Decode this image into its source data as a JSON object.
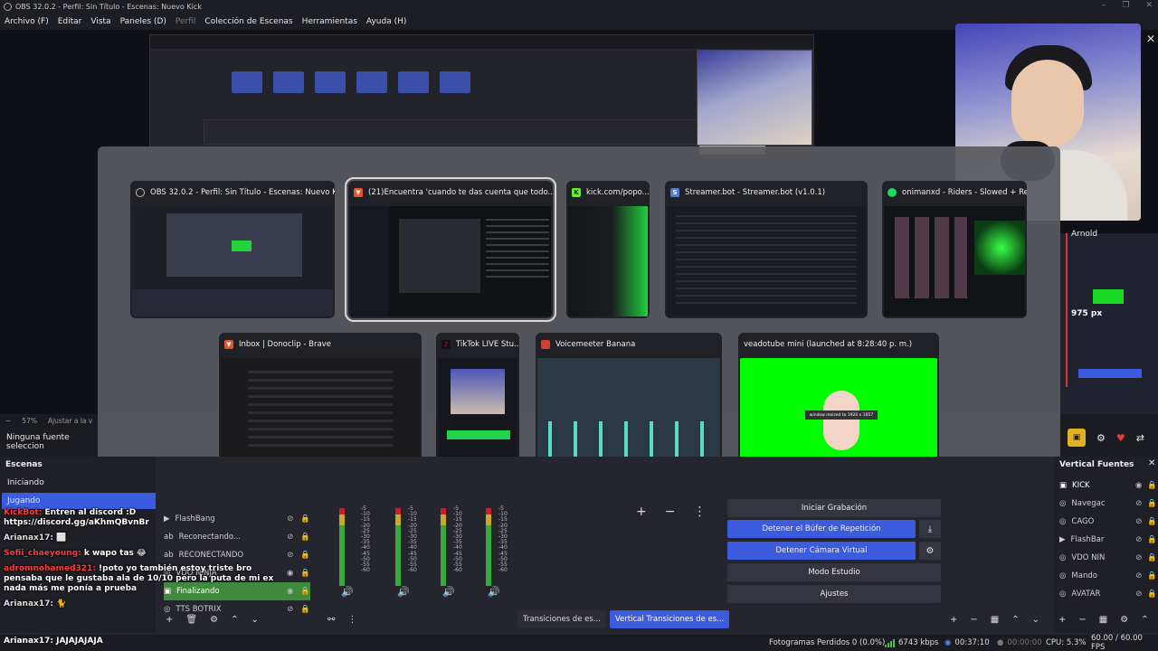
{
  "titlebar": {
    "title": "OBS 32.0.2 - Perfil: Sin Título - Escenas: Nuevo Kick"
  },
  "menu": [
    "Archivo (F)",
    "Editar",
    "Vista",
    "Paneles (D)",
    "Perfil",
    "Colección de Escenas",
    "Herramientas",
    "Ayuda (H)"
  ],
  "switcher": {
    "windows": [
      {
        "title": "OBS 32.0.2 - Perfil: Sin Título - Escenas: Nuevo Kick",
        "icon": "obs-icon",
        "color": "#b0b0b0"
      },
      {
        "title": "(21)Encuentra 'cuando te das cuenta que todo...",
        "icon": "brave-icon",
        "color": "#e5542d",
        "selected": true
      },
      {
        "title": "kick.com/popo...",
        "icon": "kick-icon",
        "color": "#53fc18"
      },
      {
        "title": "Streamer.bot - Streamer.bot (v1.0.1)",
        "icon": "streamerbot-icon",
        "color": "#4a7be0"
      },
      {
        "title": "onimanxd - Riders - Slowed + Rev...",
        "icon": "spotify-icon",
        "color": "#1ed760"
      },
      {
        "title": "Inbox | Donoclip - Brave",
        "icon": "brave-icon",
        "color": "#e5542d"
      },
      {
        "title": "TikTok LIVE Stu...",
        "icon": "tiktok-icon",
        "color": "#ee1d52"
      },
      {
        "title": "Voicemeeter Banana",
        "icon": "voicemeeter-icon",
        "color": "#d04030"
      },
      {
        "title": "veadotube mini (launched at 8:28:40 p. m.)",
        "icon": "",
        "color": ""
      }
    ],
    "veadotube_tag": "window resized to 1920 x 1057"
  },
  "preview": {
    "px_label": "975 px",
    "arnold_label": "Arnold"
  },
  "zoom": {
    "value": "57%",
    "fit": "Ajustar a la v"
  },
  "no_source": "Ninguna fuente seleccion",
  "scenes": {
    "title": "Escenas",
    "items": [
      "Iniciando",
      "Jugando"
    ],
    "active": "Jugando"
  },
  "sources": {
    "items": [
      "FlashBang",
      "Reconectando...",
      "RECONECTANDO",
      "VDO NINJA",
      "Finalizando",
      "TTS BOTRIX"
    ]
  },
  "mixer": {
    "scale": [
      "-5",
      "-10",
      "-15",
      "-20",
      "-25",
      "-30",
      "-35",
      "-40",
      "-45",
      "-50",
      "-55",
      "-60"
    ]
  },
  "transitions": {
    "tab1": "Transiciones de es...",
    "tab2": "Vertical Transiciones de es..."
  },
  "controls": {
    "start_recording": "Iniciar Grabación",
    "stop_replay": "Detener el Búfer de Repetición",
    "stop_virtual_cam": "Detener Cámara Virtual",
    "studio_mode": "Modo Estudio",
    "settings": "Ajustes"
  },
  "vertical_sources": {
    "title": "Vertical Fuentes",
    "items": [
      "KICK",
      "Navegac",
      "CAGO",
      "FlashBar",
      "VDO NIN",
      "Mando",
      "AVATAR"
    ]
  },
  "chat": {
    "messages": [
      {
        "user": "KickBot:",
        "text": "Entren al discord :D https://discord.gg/aKhmQBvnBr",
        "red": true
      },
      {
        "user": "Arianax17:",
        "text": "⬜",
        "red": false
      },
      {
        "user": "Sofii_chaeyoung:",
        "text": "k wapo tas 😂",
        "red": true
      },
      {
        "user": "adromnohamed321:",
        "text": "!poto yo también estoy triste bro pensaba que le gustaba ala de 10/10 pero la puta de mi ex nada más me ponía a prueba",
        "red": true
      },
      {
        "user": "Arianax17:",
        "text": "🐈",
        "red": false
      }
    ],
    "last": "Arianax17: JAJAJAJAJA"
  },
  "statusbar": {
    "dropped": "Fotogramas Perdidos 0 (0.0%)",
    "bitrate": "6743 kbps",
    "stream_time": "00:37:10",
    "rec_time": "00:00:00",
    "cpu": "CPU: 5.3%",
    "fps": "60.00 / 60.00 FPS"
  }
}
